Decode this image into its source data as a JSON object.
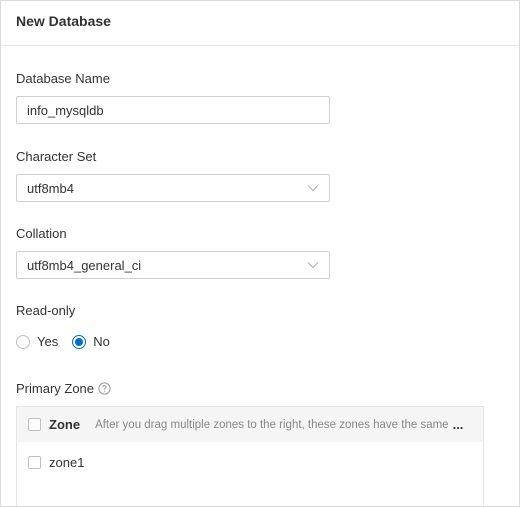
{
  "dialog": {
    "title": "New Database"
  },
  "form": {
    "database_name": {
      "label": "Database Name",
      "value": "info_mysqldb"
    },
    "character_set": {
      "label": "Character Set",
      "value": "utf8mb4"
    },
    "collation": {
      "label": "Collation",
      "value": "utf8mb4_general_ci"
    },
    "read_only": {
      "label": "Read-only",
      "options": [
        {
          "label": "Yes",
          "selected": false
        },
        {
          "label": "No",
          "selected": true
        }
      ]
    },
    "primary_zone": {
      "label": "Primary Zone",
      "table": {
        "column_title": "Zone",
        "hint": "After you drag multiple zones to the right, these zones have the same",
        "ellipsis": "...",
        "rows": [
          {
            "name": "zone1",
            "checked": false
          }
        ]
      }
    }
  },
  "colors": {
    "accent": "#0070cc",
    "border": "#d0d0d0",
    "header_bg": "#f5f5f5"
  },
  "icons": {
    "select_arrow": "chevron-down-icon",
    "help": "question-circle-icon"
  }
}
